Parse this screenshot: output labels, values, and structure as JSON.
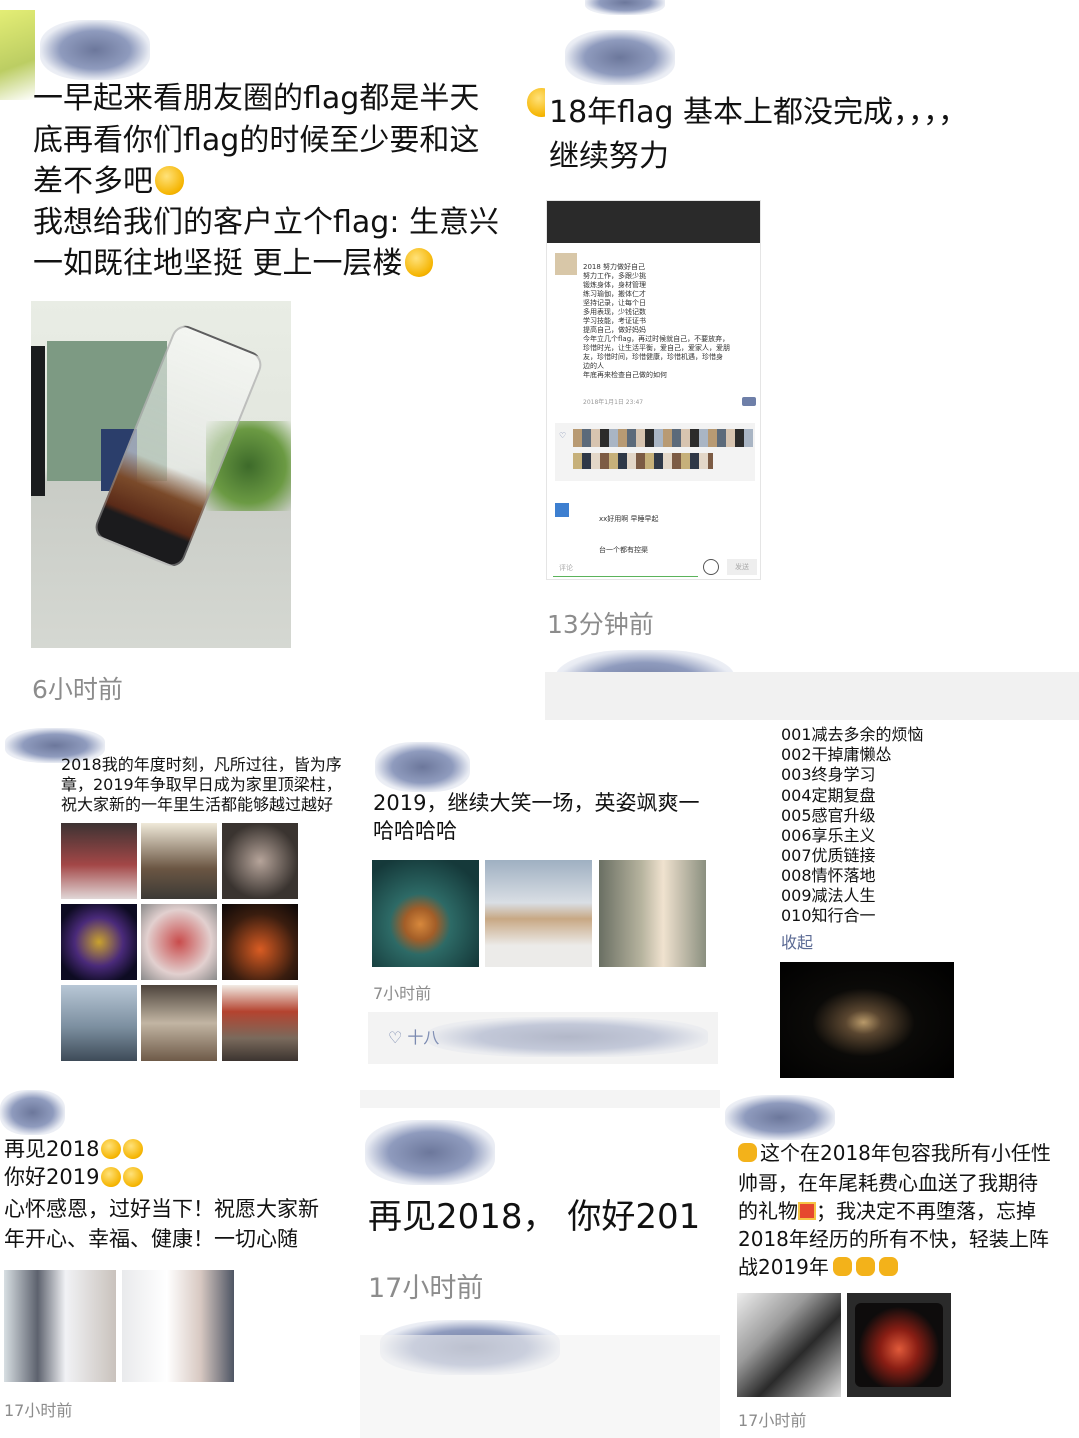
{
  "post1": {
    "lines": [
      "一早起来看朋友圈的flag都是半天",
      "底再看你们flag的时候至少要和这",
      "差不多吧",
      "我想给我们的客户立个flag: 生意兴",
      "一如既往地坚挺 更上一层楼"
    ],
    "time": "6小时前"
  },
  "post2": {
    "lines": [
      "18年flag 基本上都没完成，，，，",
      "继续努力"
    ],
    "time": "13分钟前",
    "screenshot_lines": [
      "2018 努力做好自己",
      "努力工作，多跟少挑",
      "锻炼身体，身材管理",
      "练习瑜伽，搬体仁才",
      "坚持记录，让每个日",
      "多用表现，少钱记数",
      "学习技能，考证证书",
      "提高自己，做好妈妈",
      "今年立几个flag，再过时候就自己，不要放弃，",
      "珍惜时光，让生活平衡，爱自己，爱家人，爱朋",
      "友，珍惜时间，珍惜健康，珍惜机遇，珍惜身",
      "边的人",
      "年底再来检查自己做的如何"
    ],
    "screenshot_time": "2018年1月1日 23:47",
    "screenshot_comment1": "xx好用啊 早睡早起",
    "screenshot_comment2": "台一个都有控渠",
    "screenshot_input": "评论",
    "screenshot_send": "发送"
  },
  "post3": {
    "lines": [
      "2018我的年度时刻，凡所过往，皆为序",
      "章，2019年争取早日成为家里顶梁柱，",
      "祝大家新的一年里生活都能够越过越好"
    ]
  },
  "post4": {
    "lines": [
      "2019，继续大笑一场，英姿飒爽一",
      "哈哈哈哈"
    ],
    "time": "7小时前",
    "likes": "♡ 十八"
  },
  "post5": {
    "items": [
      "001减去多余的烦恼",
      "002干掉庸懒怂",
      "003终身学习",
      "004定期复盘",
      "005感官升级",
      "006享乐主义",
      "007优质链接",
      "008情怀落地",
      "009减法人生",
      "010知行合一"
    ],
    "collapse": "收起"
  },
  "post6": {
    "lines": [
      "再见2018",
      "你好2019",
      "心怀感恩，过好当下！祝愿大家新",
      "年开心、幸福、健康！一切心随"
    ],
    "time": "17小时前"
  },
  "post7": {
    "line": "再见2018，  你好201",
    "time": "17小时前"
  },
  "post8": {
    "lines": [
      "这个在2018年包容我所有小任性",
      "帅哥，在年尾耗费心血送了我期待",
      "的礼物",
      "；我决定不再堕落，忘掉",
      "2018年经历的所有不快，轻装上阵",
      "战2019年"
    ],
    "time": "17小时前"
  }
}
